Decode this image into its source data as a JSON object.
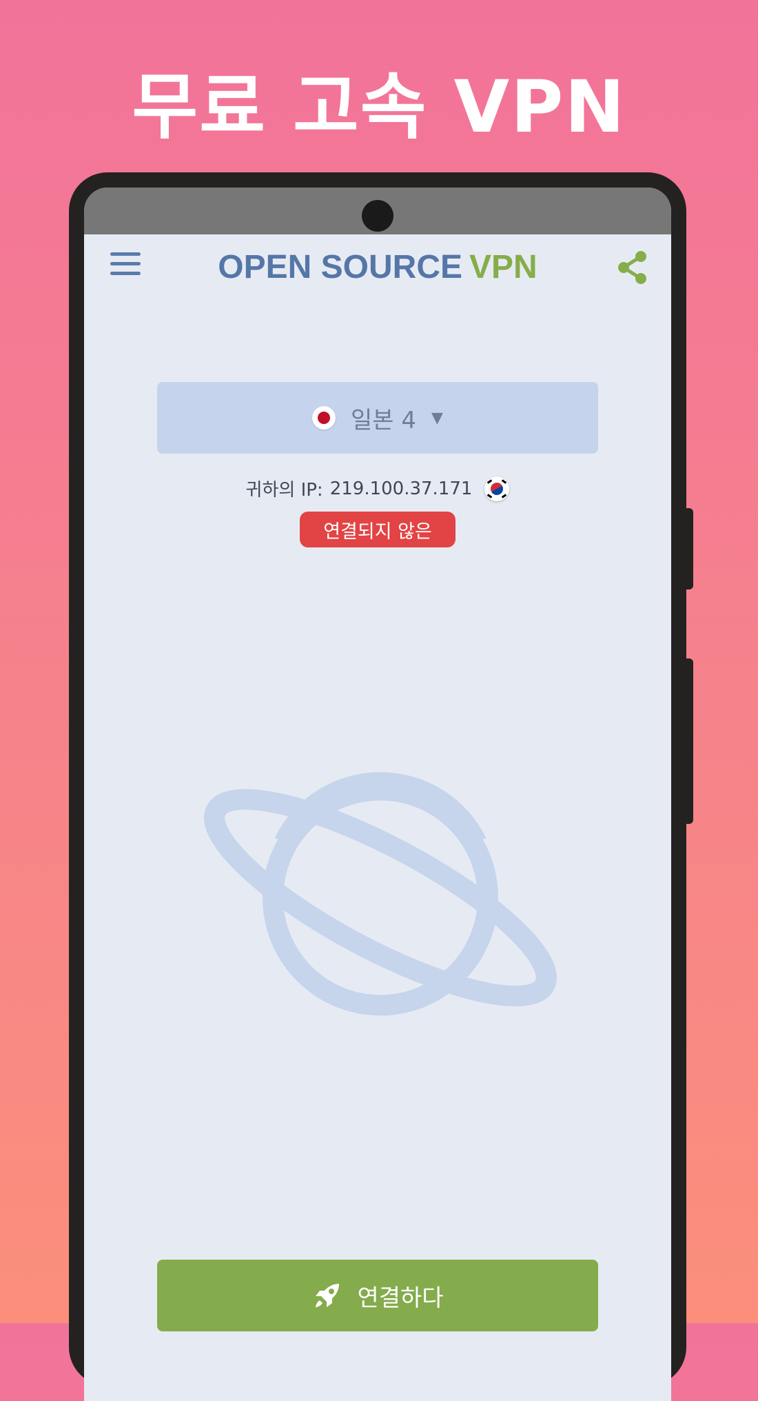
{
  "promo": {
    "headline": "무료 고속 VPN"
  },
  "app": {
    "brand_left": "OPEN SOURCE",
    "brand_right": "VPN",
    "colors": {
      "brand_blue": "#5676a8",
      "brand_green": "#86ad4b",
      "status_red": "#e24344",
      "connect_green": "#84ab4c"
    }
  },
  "toolbar": {
    "menu_icon": "hamburger-menu-icon",
    "share_icon": "share-icon"
  },
  "server": {
    "name": "일본 4",
    "flag": "japan-flag-icon",
    "dropdown_icon": "caret-down-icon"
  },
  "connection": {
    "ip_label": "귀하의 IP:",
    "ip_value": "219.100.37.171",
    "ip_flag": "south-korea-flag-icon",
    "status": "연결되지 않은"
  },
  "illustration": {
    "icon": "planet-icon"
  },
  "connect": {
    "label": "연결하다",
    "icon": "rocket-icon"
  }
}
